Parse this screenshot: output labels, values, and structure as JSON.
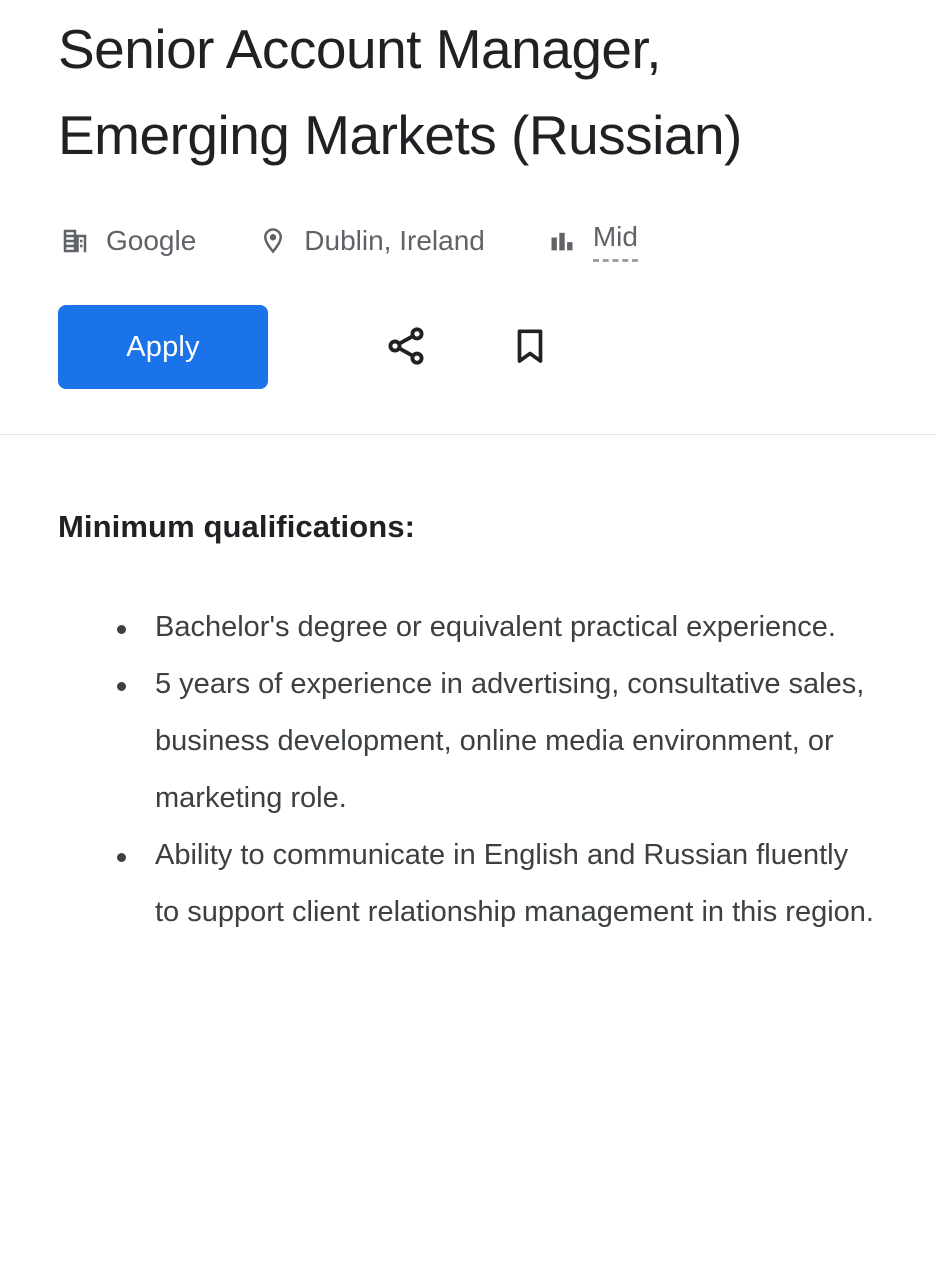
{
  "job": {
    "title": "Senior Account Manager, Emerging Markets (Russian)",
    "meta": [
      {
        "icon": "company-building-icon",
        "label": "Google",
        "kind": "company"
      },
      {
        "icon": "location-pin-icon",
        "label": "Dublin, Ireland",
        "kind": "location"
      },
      {
        "icon": "bar-chart-icon",
        "label": "Mid",
        "kind": "seniority"
      }
    ],
    "actions": {
      "apply_label": "Apply",
      "share_icon": "share-icon",
      "save_icon": "bookmark-icon"
    }
  },
  "description": {
    "heading": "Minimum qualifications:",
    "qualifications": [
      "Bachelor's degree or equivalent practical experience.",
      "5 years of experience in advertising, consultative sales, business development, online media environment, or marketing role.",
      "Ability to communicate in English and Russian fluently to support client relationship management in this region."
    ]
  },
  "colors": {
    "accent": "#1a73e8",
    "title_text": "#202124",
    "meta_text": "#5f6368",
    "body_text": "#3c4043",
    "divider": "#e2e3e5",
    "background": "#ffffff"
  }
}
